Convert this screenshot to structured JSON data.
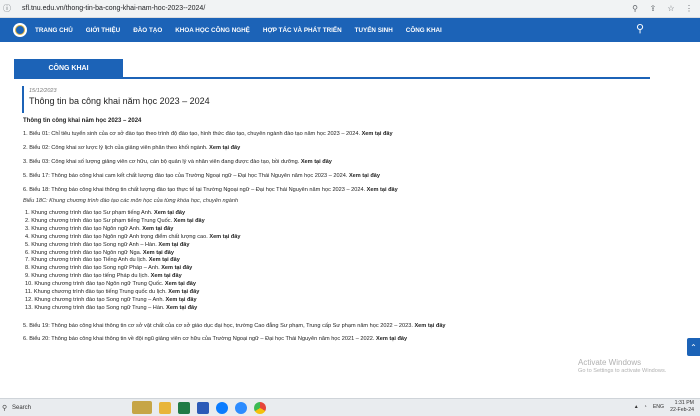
{
  "browser": {
    "url": "sfl.tnu.edu.vn/thong-tin-ba-cong-khai-nam-hoc-2023--2024/",
    "icons": [
      "search-icon",
      "share-icon",
      "star-icon",
      "more-icon"
    ]
  },
  "nav": {
    "items": [
      "TRANG CHỦ",
      "GIỚI THIỆU",
      "ĐÀO TẠO",
      "KHOA HỌC CÔNG NGHỆ",
      "HỢP TÁC VÀ PHÁT TRIỂN",
      "TUYỂN SINH",
      "CÔNG KHAI"
    ],
    "search_icon": "⚲"
  },
  "section": {
    "tab": "CÔNG KHAI"
  },
  "article": {
    "date": "15/12/2023",
    "title": "Thông tin ba công khai năm học 2023 – 2024",
    "subheading": "Thông tin công khai năm học 2023 – 2024",
    "link_text": "Xem tại đây",
    "bieu_top": [
      "1. Biểu 01: Chỉ tiêu tuyển sinh của cơ sở đào tạo theo trình độ đào tạo, hình thức đào tạo, chuyên ngành đào tạo năm học 2023 –  2024.",
      "2. Biểu 02: Công khai sơ lược lý lịch của giảng viên phân theo khối ngành.",
      "3. Biểu 03: Công khai số lượng giảng viên cơ hữu, cán bộ quản lý và nhân viên đang được đào tạo, bồi dưỡng.",
      "5. Biểu 17: Thông báo công khai cam kết chất lượng đào tạo của Trường Ngoại ngữ – Đại học Thái Nguyên năm học 2023 – 2024.",
      "6. Biểu 18: Thông báo công khai thông tin chất lượng đào tạo thực tế tại Trường Ngoại ngữ – Đại học Thái Nguyên năm học 2023 – 2024."
    ],
    "caption": "Biểu 18C: Khung chương trình đào tạo các môn học của từng khóa học, chuyên ngành",
    "programs": [
      "1. Khung chương trình đào tạo Sư phạm tiếng Anh.",
      "2. Khung chương trình đào tạo Sư phạm tiếng Trung Quốc.",
      "3. Khung chương trình đào tạo Ngôn ngữ Anh.",
      "4. Khung chương trình đào tạo Ngôn ngữ Anh trọng điểm chất lượng cao.",
      "5. Khung chương trình đào tạo Song ngữ Anh – Hàn.",
      "6. Khung chương trình đào tạo Ngôn ngữ Nga.",
      "7. Khung chương trình đào tạo Tiếng Anh du lịch.",
      "8. Khung chương trình đào tạo Song ngữ Pháp – Anh.",
      "9. Khung chương trình đào tạo tiếng Pháp du lịch.",
      "10. Khung chương trình đào tạo Ngôn ngữ Trung Quốc.",
      "11. Khung chương trình đào tạo tiếng Trung quốc du lịch.",
      "12. Khung chương trình đào tạo Song ngữ Trung – Anh.",
      "13. Khung chương trình đào tạo Song ngữ Trung – Hàn."
    ],
    "bieu_bottom": [
      "5. Biểu 19: Thông báo công khai thông tin cơ sở vật chất của cơ sở giáo dục đại học, trường Cao đẳng Sư phạm, Trung cấp Sư phạm năm học 2022 – 2023.",
      "6. Biểu 20: Thông báo công khai thông tin về đội ngũ giảng viên cơ hữu của Trường Ngoại ngữ – Đại học Thái Nguyên năm học 2021 – 2022."
    ]
  },
  "watermark": {
    "line1": "Activate Windows",
    "line2": "Go to Settings to activate Windows."
  },
  "taskbar": {
    "search": "Search",
    "apps": [
      {
        "name": "file-explorer-icon",
        "color": "#e8b53a"
      },
      {
        "name": "excel-icon",
        "color": "#1f7a45"
      },
      {
        "name": "word-icon",
        "color": "#2b5ab7"
      },
      {
        "name": "zalo-icon",
        "color": "#0a7cff"
      },
      {
        "name": "zoom-icon",
        "color": "#2d8cff"
      },
      {
        "name": "chrome-icon",
        "color": "#e6453a"
      }
    ],
    "lang": "ENG",
    "time": "1:31 PM",
    "date": "22-Feb-24"
  }
}
